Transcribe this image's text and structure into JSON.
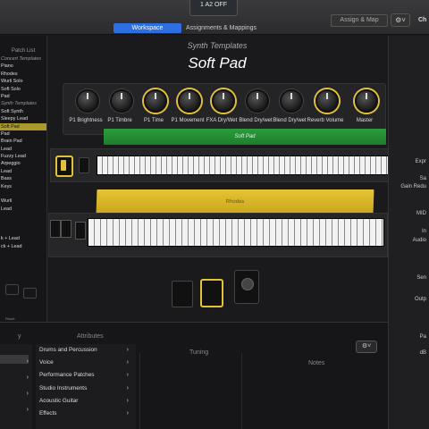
{
  "lcd": {
    "value": "1  A2  OFF",
    "sub": ""
  },
  "header": {
    "tabs": [
      {
        "label": "Workspace",
        "active": true
      },
      {
        "label": "Assignments & Mappings"
      }
    ],
    "assign_button": "Assign & Map",
    "gear_label": "⚙︎˅",
    "right_label": "Ch"
  },
  "patch_list": {
    "header": "Patch List",
    "items": [
      {
        "label": "Concert Templates",
        "type": "cat"
      },
      {
        "label": "Piano"
      },
      {
        "label": "Rhodes"
      },
      {
        "label": "Wurli Solo"
      },
      {
        "label": "Soft Solo"
      },
      {
        "label": "Pad"
      },
      {
        "label": "Synth Templates",
        "type": "cat"
      },
      {
        "label": "Soft Synth"
      },
      {
        "label": "Sleepy Lead"
      },
      {
        "label": "Soft Pad",
        "selected": true
      },
      {
        "label": "Pad"
      },
      {
        "label": "Brain Pad"
      },
      {
        "label": "Lead"
      },
      {
        "label": "Fuzzy Lead"
      },
      {
        "label": "Arpeggio"
      },
      {
        "label": "Lead"
      },
      {
        "label": "Bass"
      },
      {
        "label": "Keys"
      },
      {
        "label": ""
      },
      {
        "label": "Wurli"
      },
      {
        "label": "Lead"
      },
      {
        "label": ""
      },
      {
        "label": ""
      },
      {
        "label": ""
      },
      {
        "label": "k + Lead"
      },
      {
        "label": "ck + Lead"
      }
    ],
    "reset_label": "Reset"
  },
  "workspace": {
    "subtitle": "Synth Templates",
    "title": "Soft Pad",
    "knobs": [
      {
        "label": "P1 Brightness"
      },
      {
        "label": "P1 Timbre"
      },
      {
        "label": "P1 Time"
      },
      {
        "label": "P1 Movement"
      },
      {
        "label": "FXA Dry/Wet"
      },
      {
        "label": "Blend Dry/wet"
      },
      {
        "label": "Blend Dry/wet"
      },
      {
        "label": "Reverb Volume"
      },
      {
        "label": "Master"
      }
    ],
    "patch_bar_1": "Soft Pad",
    "patch_bar_2": "Rhodes"
  },
  "right_strip": {
    "labels": [
      "Expr",
      "Sa",
      "Gain Redu",
      "MID",
      "In",
      "Audio",
      "Sen",
      "Outp",
      "Pa",
      "dB"
    ]
  },
  "bottom": {
    "left_header": "y",
    "attributes_header": "Attributes",
    "tuning_header": "Tuning",
    "notes_header": "Notes",
    "gear_label": "⚙︎˅",
    "attributes": [
      "Drums and Percussion",
      "Voice",
      "Performance Patches",
      "Studio Instruments",
      "Acoustic Guitar",
      "Effects"
    ]
  },
  "colors": {
    "accent_blue": "#2d6fe0",
    "patch_green": "#2c9c3c",
    "patch_yellow": "#e6c434",
    "highlight": "#e3c23a"
  }
}
